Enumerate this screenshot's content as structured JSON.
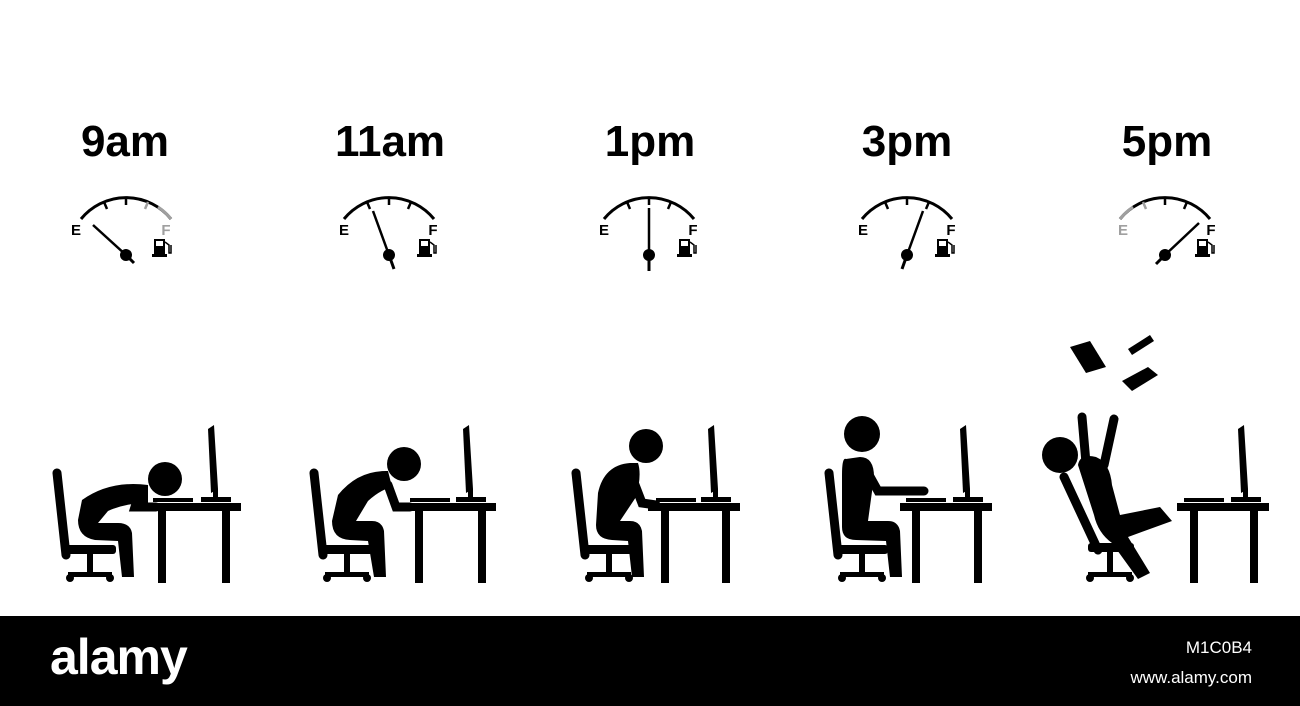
{
  "stages": [
    {
      "time": "9am",
      "fuel_level": 0.0,
      "pose": "collapsed-on-desk"
    },
    {
      "time": "11am",
      "fuel_level": 0.3,
      "pose": "slumped-forward"
    },
    {
      "time": "1pm",
      "fuel_level": 0.5,
      "pose": "hunched-working"
    },
    {
      "time": "3pm",
      "fuel_level": 0.7,
      "pose": "upright-typing"
    },
    {
      "time": "5pm",
      "fuel_level": 1.0,
      "pose": "celebrating-throwing-papers"
    }
  ],
  "gauge": {
    "empty_label": "E",
    "full_label": "F",
    "icon": "fuel-pump-icon"
  },
  "footer": {
    "brand": "alamy",
    "image_id": "M1C0B4",
    "site": "www.alamy.com"
  },
  "colors": {
    "ink": "#000000",
    "background": "#ffffff",
    "footer_bg": "#000000",
    "footer_text": "#ffffff",
    "gauge_faded": "#a0a0a0"
  }
}
